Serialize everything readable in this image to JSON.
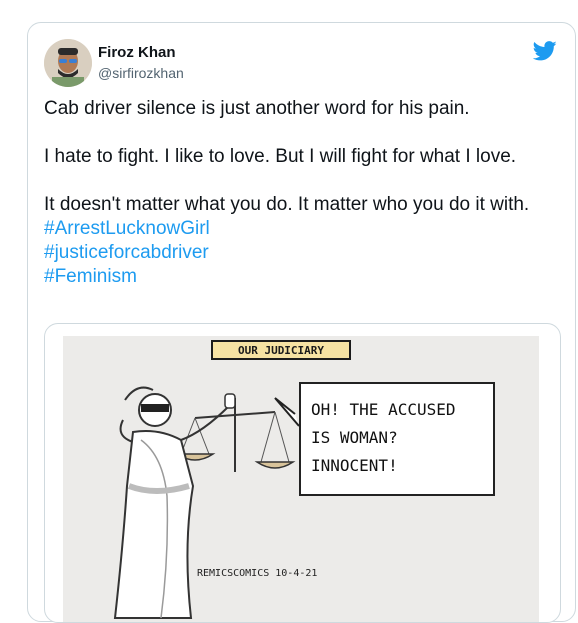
{
  "tweet": {
    "author_name": "Firoz Khan",
    "author_handle": "@sirfirozkhan",
    "paragraphs": [
      "Cab driver silence is just another word for his pain.",
      "I hate to fight. I like to love. But I will fight for what I love.",
      "It doesn't matter what you do. It matter who you do it with."
    ],
    "hashtags": [
      "#ArrestLucknowGirl",
      "#justiceforcabdriver",
      "#Feminism"
    ],
    "icon": "twitter-bird-icon",
    "colors": {
      "link": "#1d9bf0",
      "twitter_blue": "#1d9bf0",
      "handle": "#536471"
    }
  },
  "media": {
    "comic_title": "OUR JUDICIARY",
    "speech_lines": [
      "OH! THE ACCUSED",
      "IS WOMAN?",
      "INNOCENT!"
    ],
    "credit": "REMICSCOMICS 10-4-21",
    "colors": {
      "title_bg": "#f6e2a3"
    }
  }
}
